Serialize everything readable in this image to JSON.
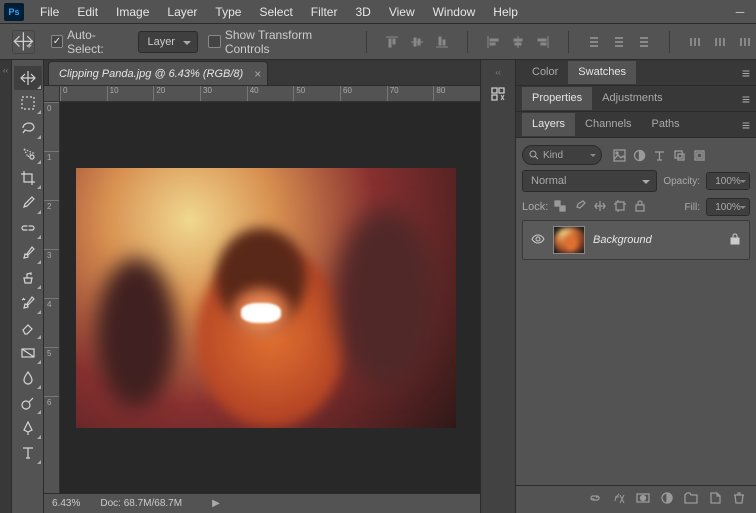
{
  "menubar": [
    "File",
    "Edit",
    "Image",
    "Layer",
    "Type",
    "Select",
    "Filter",
    "3D",
    "View",
    "Window",
    "Help"
  ],
  "options": {
    "auto_select_label": "Auto-Select:",
    "auto_select_dropdown": "Layer",
    "show_transform_label": "Show Transform Controls"
  },
  "document": {
    "tab_title": "Clipping Panda.jpg @ 6.43% (RGB/8)",
    "zoom": "6.43%",
    "doc_size": "Doc: 68.7M/68.7M",
    "ruler_h": [
      "0",
      "10",
      "20",
      "30",
      "40",
      "50",
      "60",
      "70",
      "80"
    ],
    "ruler_v": [
      "0",
      "1",
      "2",
      "3",
      "4",
      "5",
      "6"
    ]
  },
  "panels": {
    "color_tabs": [
      "Color",
      "Swatches"
    ],
    "properties_tabs": [
      "Properties",
      "Adjustments"
    ],
    "layers_tabs": [
      "Layers",
      "Channels",
      "Paths"
    ],
    "kind_label": "Kind",
    "blend_mode": "Normal",
    "opacity_label": "Opacity:",
    "opacity_value": "100%",
    "lock_label": "Lock:",
    "fill_label": "Fill:",
    "fill_value": "100%",
    "layer_name": "Background"
  }
}
